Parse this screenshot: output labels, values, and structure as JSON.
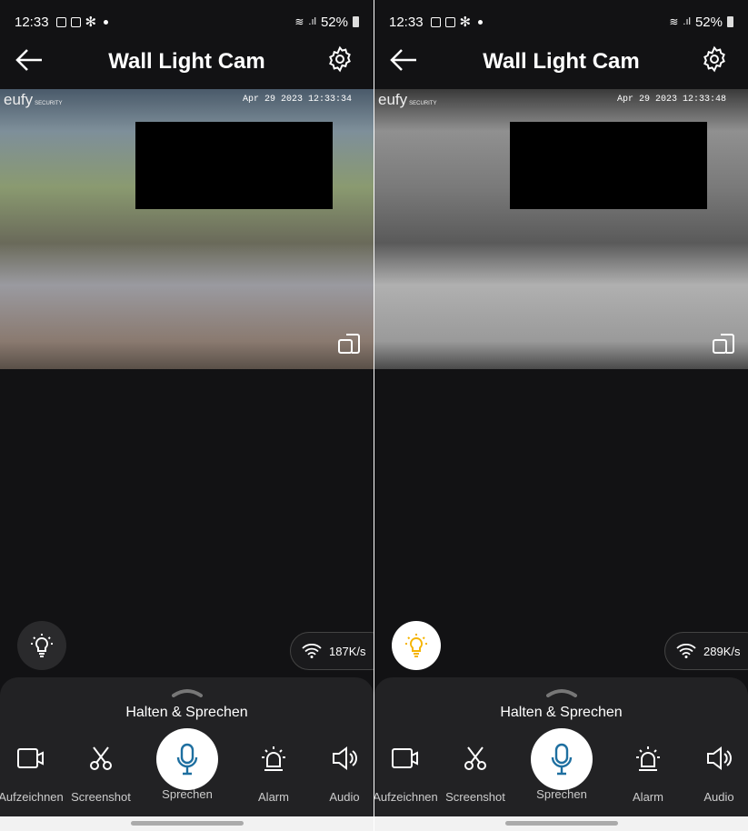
{
  "status_bar": {
    "time": "12:33",
    "battery": "52%"
  },
  "header": {
    "title": "Wall Light Cam"
  },
  "panels": [
    {
      "timestamp": "Apr 29 2023  12:33:34",
      "net_speed": "187K/s",
      "light_on": false
    },
    {
      "timestamp": "Apr 29 2023  12:33:48",
      "net_speed": "289K/s",
      "light_on": true
    }
  ],
  "logo": {
    "brand": "eufy",
    "sub": "SECURITY"
  },
  "sheet": {
    "hold_label": "Halten & Sprechen",
    "actions": [
      {
        "label": "Aufzeichnen",
        "icon": "video-camera-icon"
      },
      {
        "label": "Screenshot",
        "icon": "scissors-icon"
      },
      {
        "label": "Sprechen",
        "icon": "microphone-icon"
      },
      {
        "label": "Alarm",
        "icon": "siren-icon"
      },
      {
        "label": "Audio",
        "icon": "speaker-icon"
      }
    ]
  },
  "colors": {
    "accent": "#1e6fa0",
    "light_on": "#f5b400",
    "background": "#121214",
    "sheet": "#222224"
  }
}
